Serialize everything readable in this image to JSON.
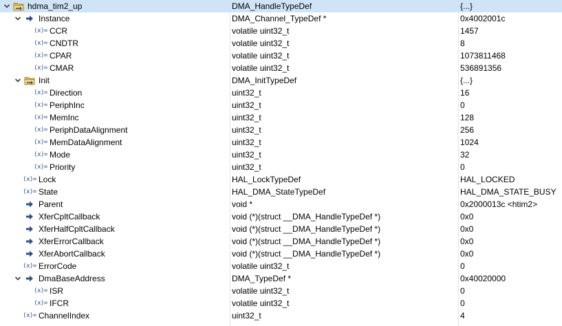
{
  "icons": {
    "variable": "variable-icon",
    "pointer": "pointer-arrow-icon",
    "struct": "struct-folder-icon",
    "expand": "chevron-down-icon",
    "var_glyph": "(x)="
  },
  "colors": {
    "selected_row": "#cfe4f7",
    "twisty": "#3d3d3d",
    "pointer_arrow": "#2c4f8a",
    "folder": "#e7b84b"
  },
  "rows": [
    {
      "name": "hdma_tim2_up",
      "type": "DMA_HandleTypeDef",
      "value": "{...}",
      "depth": 0,
      "expanded": true,
      "icon": "struct"
    },
    {
      "name": "Instance",
      "type": "DMA_Channel_TypeDef *",
      "value": "0x4002001c",
      "depth": 1,
      "expanded": true,
      "icon": "pointer"
    },
    {
      "name": "CCR",
      "type": "volatile uint32_t",
      "value": "1457",
      "depth": 2,
      "icon": "var"
    },
    {
      "name": "CNDTR",
      "type": "volatile uint32_t",
      "value": "8",
      "depth": 2,
      "icon": "var"
    },
    {
      "name": "CPAR",
      "type": "volatile uint32_t",
      "value": "1073811468",
      "depth": 2,
      "icon": "var"
    },
    {
      "name": "CMAR",
      "type": "volatile uint32_t",
      "value": "536891356",
      "depth": 2,
      "icon": "var"
    },
    {
      "name": "Init",
      "type": "DMA_InitTypeDef",
      "value": "{...}",
      "depth": 1,
      "expanded": true,
      "icon": "struct"
    },
    {
      "name": "Direction",
      "type": "uint32_t",
      "value": "16",
      "depth": 2,
      "icon": "var"
    },
    {
      "name": "PeriphInc",
      "type": "uint32_t",
      "value": "0",
      "depth": 2,
      "icon": "var"
    },
    {
      "name": "MemInc",
      "type": "uint32_t",
      "value": "128",
      "depth": 2,
      "icon": "var"
    },
    {
      "name": "PeriphDataAlignment",
      "type": "uint32_t",
      "value": "256",
      "depth": 2,
      "icon": "var"
    },
    {
      "name": "MemDataAlignment",
      "type": "uint32_t",
      "value": "1024",
      "depth": 2,
      "icon": "var"
    },
    {
      "name": "Mode",
      "type": "uint32_t",
      "value": "32",
      "depth": 2,
      "icon": "var"
    },
    {
      "name": "Priority",
      "type": "uint32_t",
      "value": "0",
      "depth": 2,
      "icon": "var"
    },
    {
      "name": "Lock",
      "type": "HAL_LockTypeDef",
      "value": "HAL_LOCKED",
      "depth": 1,
      "icon": "var"
    },
    {
      "name": "State",
      "type": "HAL_DMA_StateTypeDef",
      "value": "HAL_DMA_STATE_BUSY",
      "depth": 1,
      "icon": "var"
    },
    {
      "name": "Parent",
      "type": "void *",
      "value": "0x2000013c <htim2>",
      "depth": 1,
      "icon": "pointer"
    },
    {
      "name": "XferCpltCallback",
      "type": "void (*)(struct __DMA_HandleTypeDef *)",
      "value": "0x0",
      "depth": 1,
      "icon": "pointer"
    },
    {
      "name": "XferHalfCpltCallback",
      "type": "void (*)(struct __DMA_HandleTypeDef *)",
      "value": "0x0",
      "depth": 1,
      "icon": "pointer"
    },
    {
      "name": "XferErrorCallback",
      "type": "void (*)(struct __DMA_HandleTypeDef *)",
      "value": "0x0",
      "depth": 1,
      "icon": "pointer"
    },
    {
      "name": "XferAbortCallback",
      "type": "void (*)(struct __DMA_HandleTypeDef *)",
      "value": "0x0",
      "depth": 1,
      "icon": "pointer"
    },
    {
      "name": "ErrorCode",
      "type": "volatile uint32_t",
      "value": "0",
      "depth": 1,
      "icon": "var"
    },
    {
      "name": "DmaBaseAddress",
      "type": "DMA_TypeDef *",
      "value": "0x40020000",
      "depth": 1,
      "expanded": true,
      "icon": "pointer"
    },
    {
      "name": "ISR",
      "type": "volatile uint32_t",
      "value": "0",
      "depth": 2,
      "icon": "var"
    },
    {
      "name": "IFCR",
      "type": "volatile uint32_t",
      "value": "0",
      "depth": 2,
      "icon": "var"
    },
    {
      "name": "ChannelIndex",
      "type": "uint32_t",
      "value": "4",
      "depth": 1,
      "icon": "var"
    }
  ]
}
